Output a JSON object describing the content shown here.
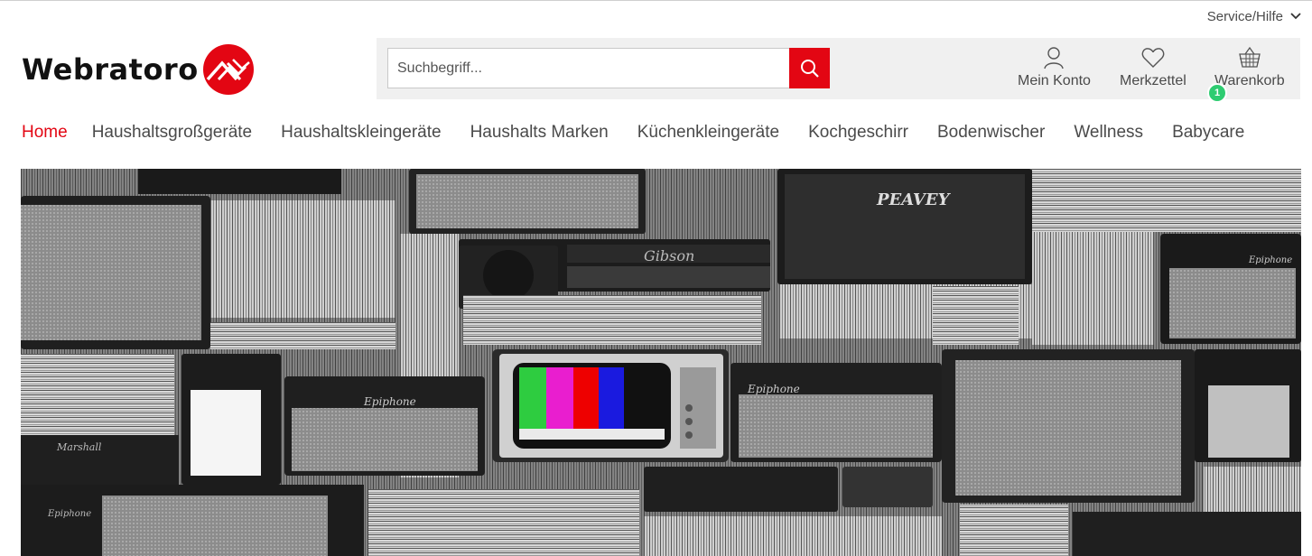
{
  "topbar": {
    "service_label": "Service/Hilfe",
    "chevron_icon": "chevron-down-icon"
  },
  "brand": {
    "name": "Webratoro",
    "logo_icon": "webratoro-logo-icon",
    "accent": "#e30613"
  },
  "search": {
    "placeholder": "Suchbegriff...",
    "value": "",
    "button_icon": "search-icon"
  },
  "account": {
    "konto_label": "Mein Konto",
    "konto_icon": "user-icon",
    "merkzettel_label": "Merkzettel",
    "merkzettel_icon": "heart-icon",
    "warenkorb_label": "Warenkorb",
    "warenkorb_icon": "basket-icon",
    "cart_count": "1",
    "badge_color": "#2ecc71"
  },
  "nav": {
    "items": [
      {
        "label": "Home",
        "active": true
      },
      {
        "label": "Haushaltsgroßgeräte",
        "active": false
      },
      {
        "label": "Haushaltskleingeräte",
        "active": false
      },
      {
        "label": "Haushalts Marken",
        "active": false
      },
      {
        "label": "Küchenkleingeräte",
        "active": false
      },
      {
        "label": "Kochgeschirr",
        "active": false
      },
      {
        "label": "Bodenwischer",
        "active": false
      },
      {
        "label": "Wellness",
        "active": false
      },
      {
        "label": "Babycare",
        "active": false
      }
    ]
  },
  "hero": {
    "image_description_icon": "amps-and-tv-photo",
    "amp_labels": [
      "PEAVEY",
      "Gibson",
      "Epiphone",
      "Epiphone",
      "Epiphone",
      "Marshall",
      "Epiphone"
    ]
  }
}
